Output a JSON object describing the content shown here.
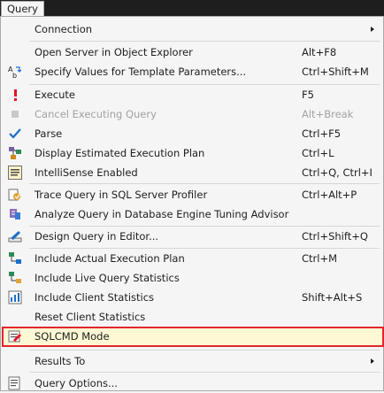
{
  "menu_title": "Query",
  "items": [
    {
      "label": "Connection",
      "shortcut": "",
      "icon": "none",
      "submenu": true
    },
    {
      "label": "Open Server in Object Explorer",
      "shortcut": "Alt+F8",
      "icon": "none"
    },
    {
      "label": "Specify Values for Template Parameters...",
      "shortcut": "Ctrl+Shift+M",
      "icon": "template-params-icon"
    },
    {
      "label": "Execute",
      "shortcut": "F5",
      "icon": "execute-icon"
    },
    {
      "label": "Cancel Executing Query",
      "shortcut": "Alt+Break",
      "icon": "cancel-icon",
      "disabled": true
    },
    {
      "label": "Parse",
      "shortcut": "Ctrl+F5",
      "icon": "parse-checkmark-icon"
    },
    {
      "label": "Display Estimated Execution Plan",
      "shortcut": "Ctrl+L",
      "icon": "execution-plan-icon"
    },
    {
      "label": "IntelliSense Enabled",
      "shortcut": "Ctrl+Q, Ctrl+I",
      "icon": "intellisense-icon"
    },
    {
      "label": "Trace Query in SQL Server Profiler",
      "shortcut": "Ctrl+Alt+P",
      "icon": "profiler-icon"
    },
    {
      "label": "Analyze Query in Database Engine Tuning Advisor",
      "shortcut": "",
      "icon": "tuning-advisor-icon"
    },
    {
      "label": "Design Query in Editor...",
      "shortcut": "Ctrl+Shift+Q",
      "icon": "design-query-icon"
    },
    {
      "label": "Include Actual Execution Plan",
      "shortcut": "Ctrl+M",
      "icon": "actual-plan-icon"
    },
    {
      "label": "Include Live Query Statistics",
      "shortcut": "",
      "icon": "live-stats-icon"
    },
    {
      "label": "Include Client Statistics",
      "shortcut": "Shift+Alt+S",
      "icon": "client-stats-icon"
    },
    {
      "label": "Reset Client Statistics",
      "shortcut": "",
      "icon": "none"
    },
    {
      "label": "SQLCMD Mode",
      "shortcut": "",
      "icon": "sqlcmd-icon",
      "highlighted": true
    },
    {
      "label": "Results To",
      "shortcut": "",
      "icon": "none",
      "submenu": true
    },
    {
      "label": "Query Options...",
      "shortcut": "",
      "icon": "query-options-icon"
    }
  ],
  "colors": {
    "highlight_border": "#e1272c",
    "highlight_fill": "#fef8d4",
    "execute_red": "#e81123",
    "check_blue": "#1e6fc7"
  }
}
